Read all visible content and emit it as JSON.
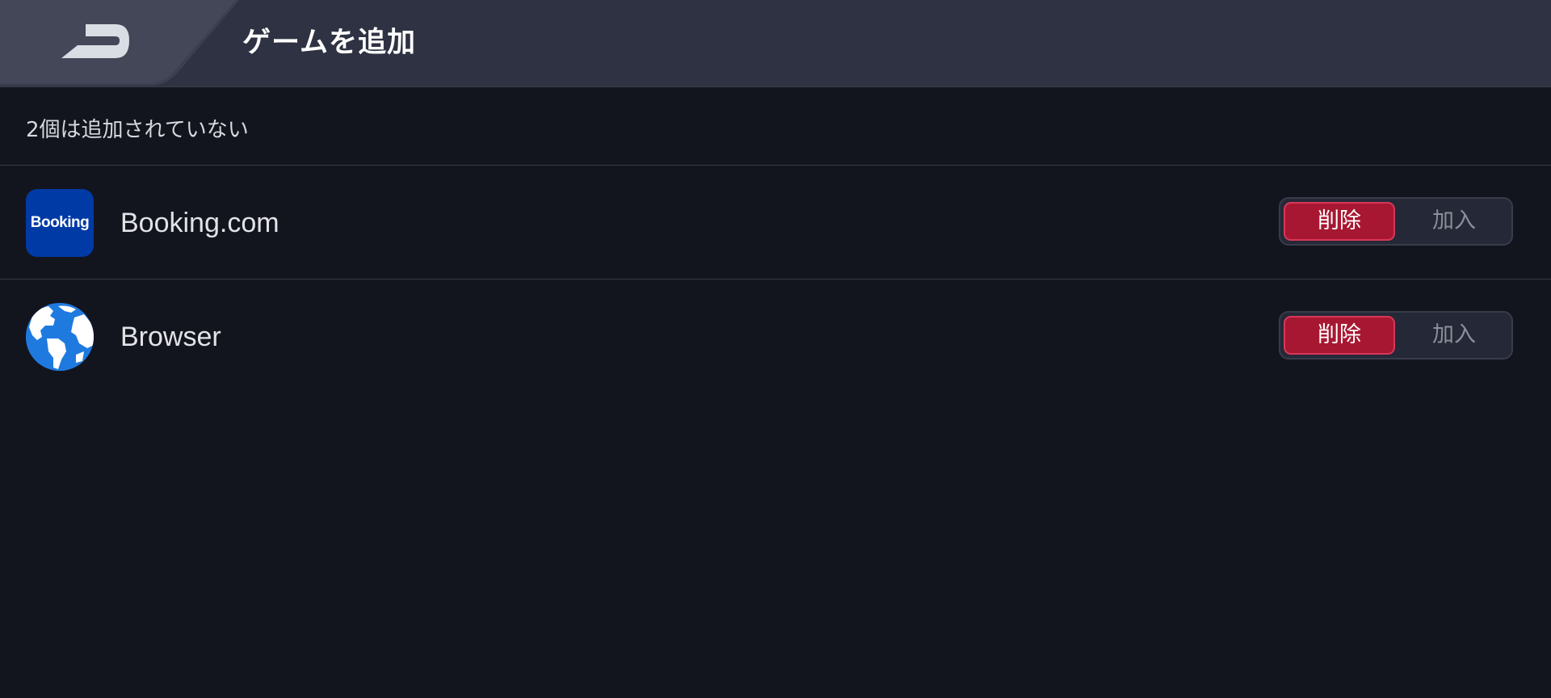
{
  "header": {
    "title": "ゲームを追加",
    "back_icon": "back-arrow-icon"
  },
  "section": {
    "label": "2個は追加されていない"
  },
  "apps": [
    {
      "name": "Booking.com",
      "icon_text": "Booking",
      "icon": "booking-app-icon",
      "icon_color": "#003aa5",
      "remove_label": "削除",
      "add_label": "加入",
      "selected": "remove"
    },
    {
      "name": "Browser",
      "icon": "globe-icon",
      "icon_color": "#1f7ae0",
      "remove_label": "削除",
      "add_label": "加入",
      "selected": "remove"
    }
  ],
  "colors": {
    "background": "#13151e",
    "header": "#2e3242",
    "accent_red": "#a81731"
  }
}
